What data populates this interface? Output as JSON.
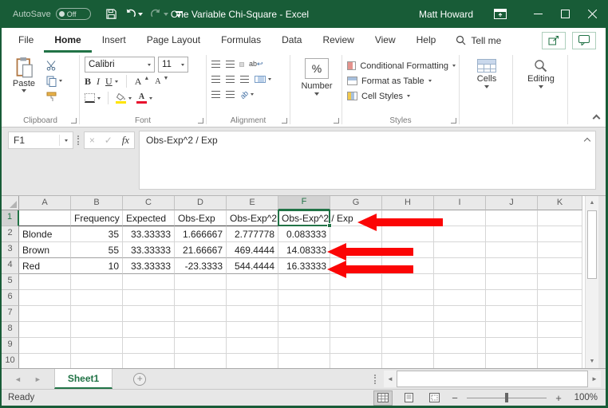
{
  "titlebar": {
    "autosave_label": "AutoSave",
    "autosave_state": "Off",
    "title": "One Variable Chi-Square  -  Excel",
    "user": "Matt Howard"
  },
  "tabs": {
    "items": [
      "File",
      "Home",
      "Insert",
      "Page Layout",
      "Formulas",
      "Data",
      "Review",
      "View",
      "Help"
    ],
    "active": "Home",
    "tellme": "Tell me"
  },
  "ribbon": {
    "clipboard": {
      "group_label": "Clipboard",
      "paste_label": "Paste"
    },
    "font": {
      "group_label": "Font",
      "family": "Calibri",
      "size": "11",
      "bold": "B",
      "italic": "I",
      "underline": "U",
      "grow_label": "A",
      "shrink_label": "A",
      "color_letter": "A"
    },
    "alignment": {
      "group_label": "Alignment",
      "wrap_label": "ab",
      "orient_label": "ab"
    },
    "number": {
      "label": "Number",
      "percent": "%"
    },
    "styles": {
      "group_label": "Styles",
      "conditional": "Conditional Formatting",
      "table": "Format as Table",
      "cell_styles": "Cell Styles"
    },
    "cells": {
      "label": "Cells"
    },
    "editing": {
      "label": "Editing"
    }
  },
  "formula_bar": {
    "name_box": "F1",
    "cancel": "×",
    "enter": "✓",
    "fx": "fx",
    "content": "Obs-Exp^2 / Exp"
  },
  "grid": {
    "columns": [
      "A",
      "B",
      "C",
      "D",
      "E",
      "F",
      "G",
      "H",
      "I",
      "J",
      "K"
    ],
    "row_numbers": [
      1,
      2,
      3,
      4,
      5,
      6,
      7,
      8,
      9,
      10
    ],
    "selected_cell": "F1",
    "selected_col": "F",
    "selected_row": 1,
    "rows": [
      {
        "r": 1,
        "cells": {
          "B": "Frequency",
          "C": "Expected",
          "D": "Obs-Exp",
          "E": "Obs-Exp^2",
          "F": "Obs-Exp^2 / Exp"
        }
      },
      {
        "r": 2,
        "cells": {
          "A": "Blonde",
          "B": "35",
          "C": "33.33333",
          "D": "1.666667",
          "E": "2.777778",
          "F": "0.083333"
        }
      },
      {
        "r": 3,
        "cells": {
          "A": "Brown",
          "B": "55",
          "C": "33.33333",
          "D": "21.66667",
          "E": "469.4444",
          "F": "14.08333"
        }
      },
      {
        "r": 4,
        "cells": {
          "A": "Red",
          "B": "10",
          "C": "33.33333",
          "D": "-23.3333",
          "E": "544.4444",
          "F": "16.33333"
        }
      }
    ]
  },
  "annotations": {
    "arrow_color": "#fb0505",
    "arrows": [
      "points at F1 header text",
      "points at F3 value 14.08333",
      "points at F4 value 16.33333"
    ]
  },
  "sheet_bar": {
    "active_tab": "Sheet1"
  },
  "status_bar": {
    "mode": "Ready",
    "zoom_level": "100%"
  },
  "colors": {
    "titlebar_green": "#185c37",
    "accent_green": "#217346",
    "arrow_red": "#fb0505"
  }
}
